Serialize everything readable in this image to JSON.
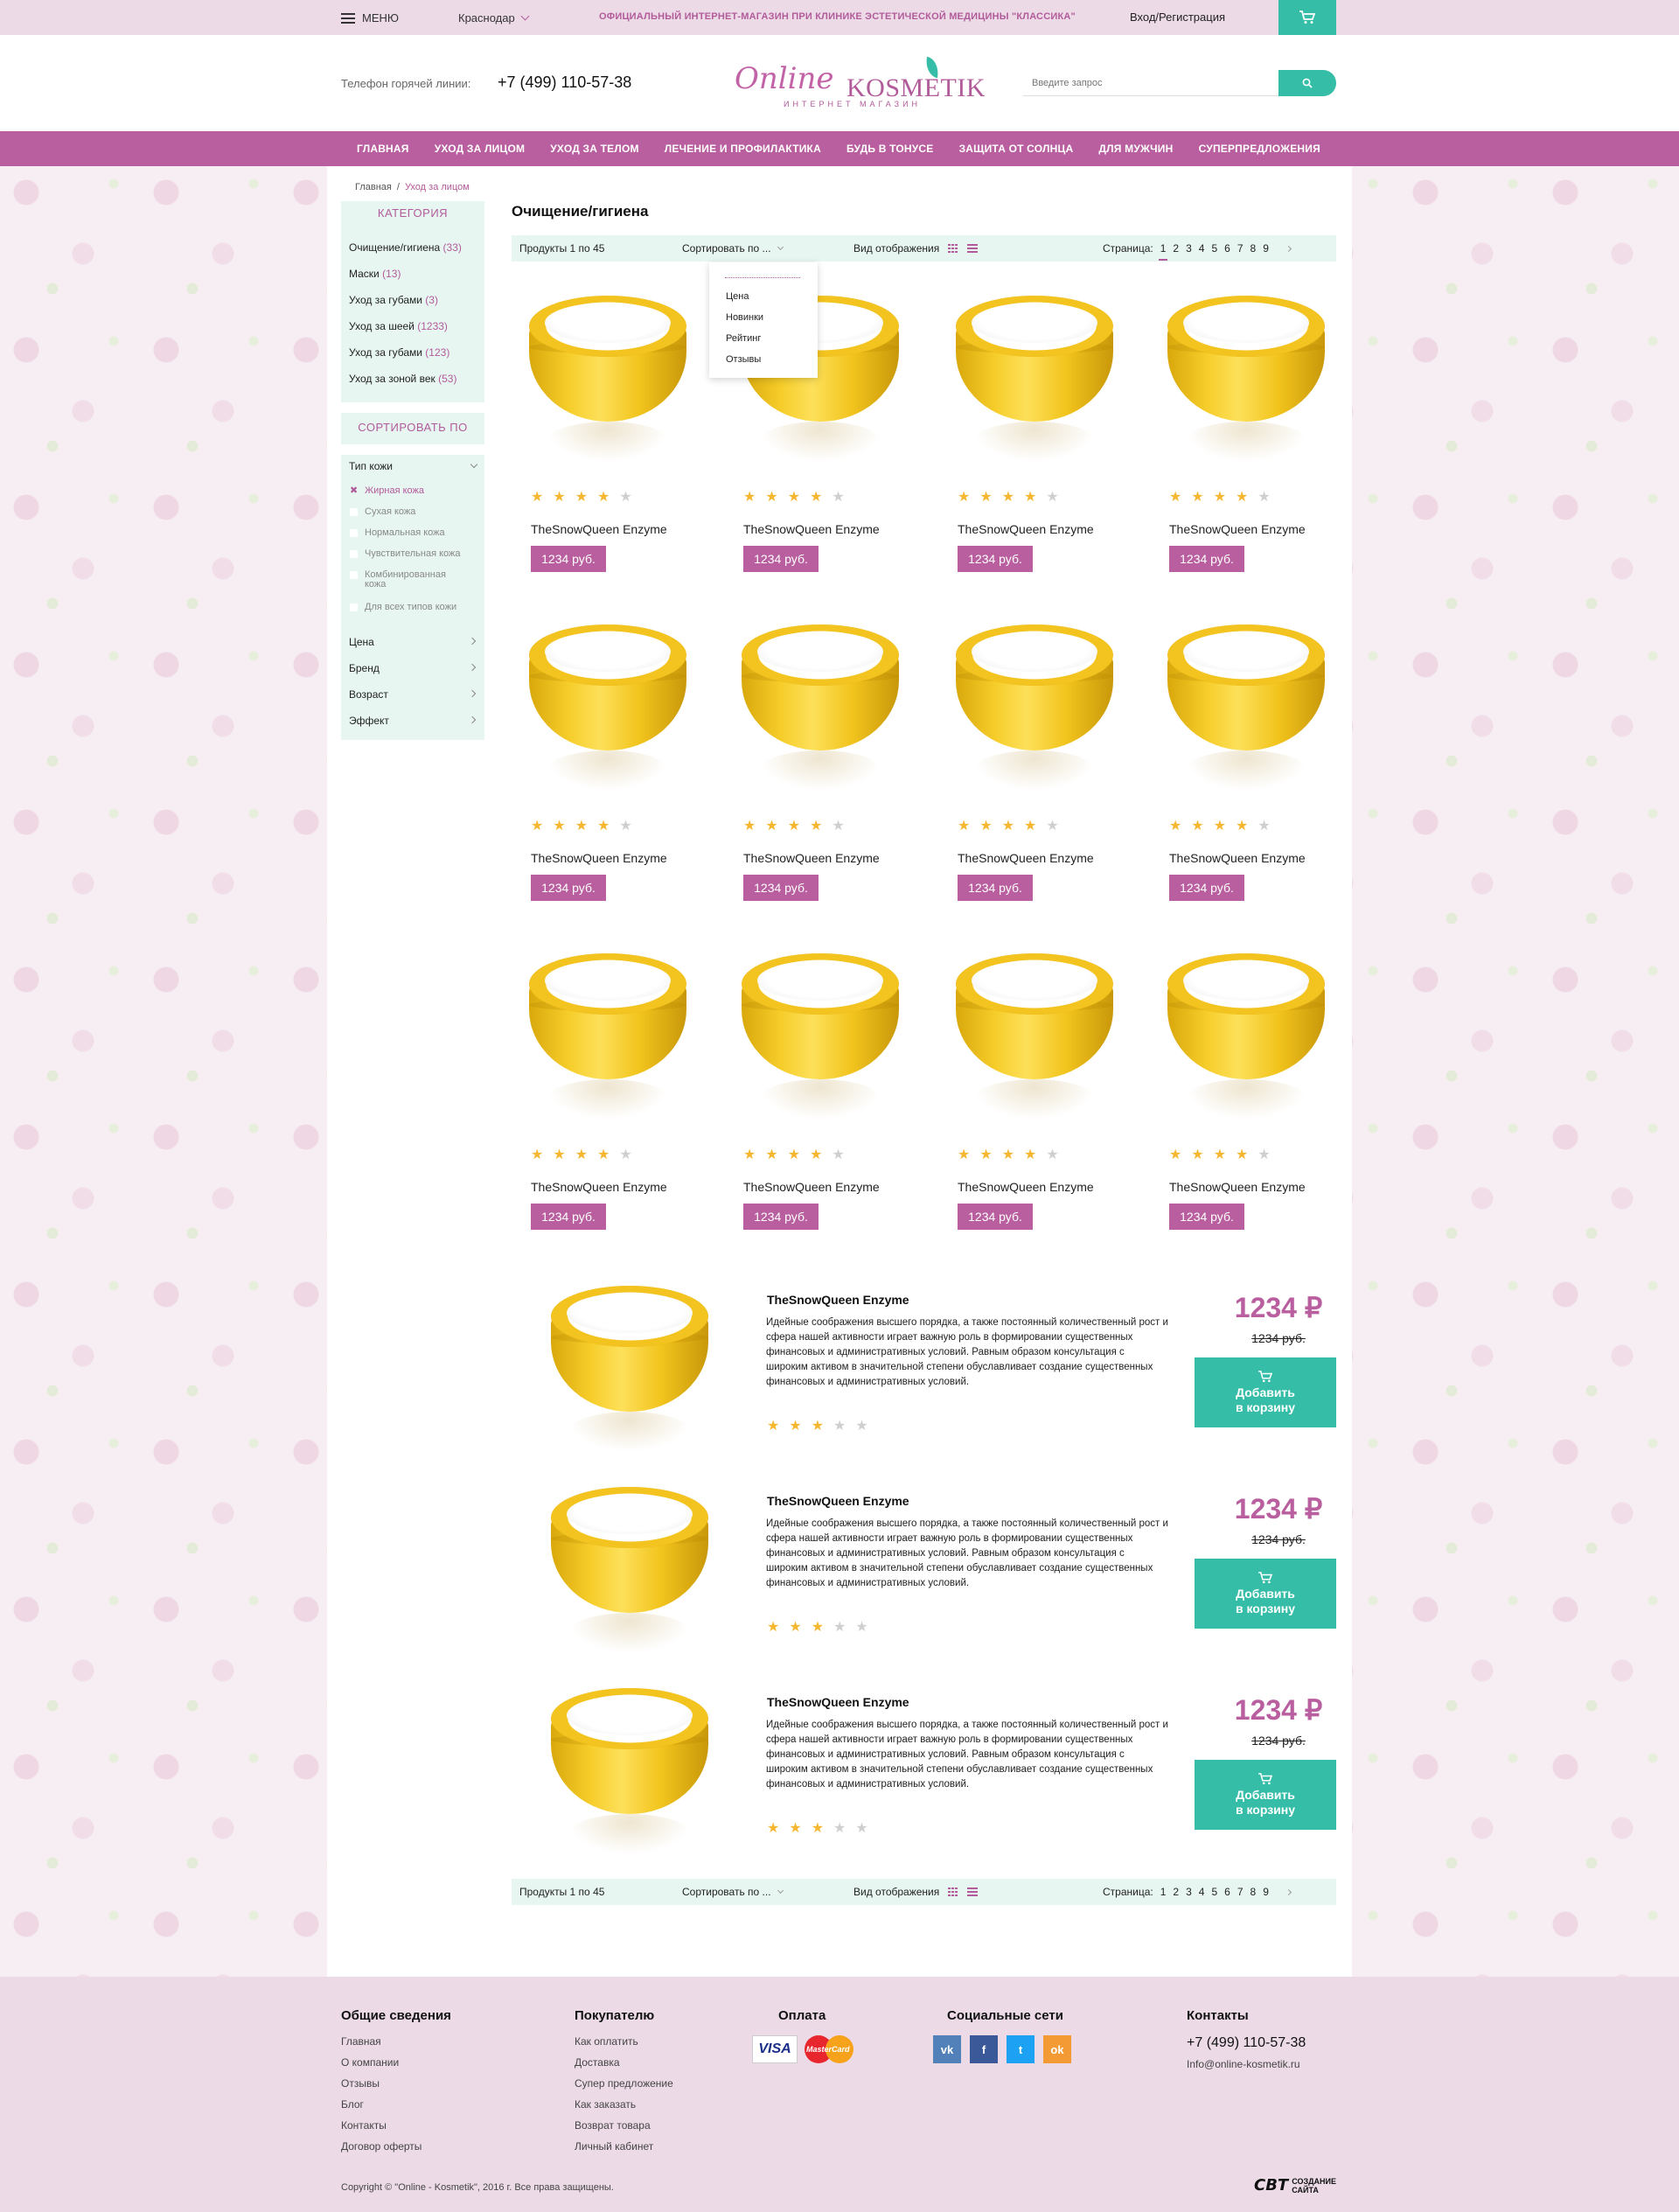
{
  "topbar": {
    "menu_label": "МЕНЮ",
    "city": "Краснодар",
    "official_text": "ОФИЦИАЛЬНЫЙ ИНТЕРНЕТ-МАГАЗИН ПРИ КЛИНИКЕ ЭСТЕТИЧЕСКОЙ МЕДИЦИНЫ \"КЛАССИКА\"",
    "login_label": "Вход/Регистрация",
    "cart_icon": "cart-icon"
  },
  "header": {
    "hotline_label": "Телефон горячей линии:",
    "hotline_phone": "+7 (499) 110-57-38",
    "logo_part1": "Online",
    "logo_part2": "KOSMETIK",
    "logo_sub": "ИНТЕРНЕТ МАГАЗИН",
    "search_placeholder": "Введите запрос",
    "search_icon": "search-icon"
  },
  "nav": [
    "ГЛАВНАЯ",
    "УХОД ЗА ЛИЦОМ",
    "УХОД ЗА ТЕЛОМ",
    "ЛЕЧЕНИЕ И ПРОФИЛАКТИКА",
    "БУДЬ В ТОНУСЕ",
    "ЗАЩИТА ОТ СОЛНЦА",
    "ДЛЯ МУЖЧИН",
    "СУПЕРПРЕДЛОЖЕНИЯ"
  ],
  "breadcrumb": {
    "home": "Главная",
    "sep": "/",
    "current": "Уход за лицом"
  },
  "sidebar": {
    "category_title": "КАТЕГОРИЯ",
    "categories": [
      {
        "label": "Очищение/гигиена",
        "count": "(33)"
      },
      {
        "label": "Маски",
        "count": "(13)"
      },
      {
        "label": "Уход за губами",
        "count": "(3)"
      },
      {
        "label": "Уход за шеей",
        "count": "(1233)"
      },
      {
        "label": "Уход за губами",
        "count": "(123)"
      },
      {
        "label": "Уход за зоной век",
        "count": "(53)"
      }
    ],
    "sort_title": "СОРТИРОВАТЬ ПО",
    "skin_type_label": "Тип кожи",
    "skin_options": [
      "Жирная кожа",
      "Сухая кожа",
      "Нормальная кожа",
      "Чувствительная кожа",
      "Комбинированная кожа",
      "Для всех типов кожи"
    ],
    "active_skin_mark": "✖",
    "filters": [
      "Цена",
      "Бренд",
      "Возраст",
      "Эффект"
    ]
  },
  "content": {
    "title": "Очищение/гигиена",
    "toolbar": {
      "count": "Продукты 1 по 45",
      "sort_label": "Сортировать по ...",
      "view_label": "Вид отображения",
      "pages_label": "Страница:",
      "pages": [
        "1",
        "2",
        "3",
        "4",
        "5",
        "6",
        "7",
        "8",
        "9"
      ],
      "current_page": "1"
    },
    "sort_options": [
      "Цена",
      "Новинки",
      "Рейтинг",
      "Отзывы"
    ],
    "grid_products": [
      {
        "name": "TheSnowQueen Enzyme",
        "price": "1234 руб.",
        "rating": 4
      },
      {
        "name": "TheSnowQueen Enzyme",
        "price": "1234 руб.",
        "rating": 4
      },
      {
        "name": "TheSnowQueen Enzyme",
        "price": "1234 руб.",
        "rating": 4
      },
      {
        "name": "TheSnowQueen Enzyme",
        "price": "1234 руб.",
        "rating": 4
      },
      {
        "name": "TheSnowQueen Enzyme",
        "price": "1234 руб.",
        "rating": 4
      },
      {
        "name": "TheSnowQueen Enzyme",
        "price": "1234 руб.",
        "rating": 4
      },
      {
        "name": "TheSnowQueen Enzyme",
        "price": "1234 руб.",
        "rating": 4
      },
      {
        "name": "TheSnowQueen Enzyme",
        "price": "1234 руб.",
        "rating": 4
      },
      {
        "name": "TheSnowQueen Enzyme",
        "price": "1234 руб.",
        "rating": 4
      },
      {
        "name": "TheSnowQueen Enzyme",
        "price": "1234 руб.",
        "rating": 4
      },
      {
        "name": "TheSnowQueen Enzyme",
        "price": "1234 руб.",
        "rating": 4
      },
      {
        "name": "TheSnowQueen Enzyme",
        "price": "1234 руб.",
        "rating": 4
      }
    ],
    "list_products": [
      {
        "name": "TheSnowQueen Enzyme",
        "description": "Идейные соображения высшего порядка, а также постоянный количественный рост и сфера нашей активности играет важную роль в формировании существенных финансовых и административных условий. Равным образом консультация с широким активом в значительной степени обуславливает создание существенных финансовых и административных условий.",
        "price": "1234 ₽",
        "old_price": "1234 руб.",
        "rating": 3,
        "button_line1": "Добавить",
        "button_line2": "в корзину"
      },
      {
        "name": "TheSnowQueen Enzyme",
        "description": "Идейные соображения высшего порядка, а также постоянный количественный рост и сфера нашей активности играет важную роль в формировании существенных финансовых и административных условий. Равным образом консультация с широким активом в значительной степени обуславливает создание существенных финансовых и административных условий.",
        "price": "1234 ₽",
        "old_price": "1234 руб.",
        "rating": 3,
        "button_line1": "Добавить",
        "button_line2": "в корзину"
      },
      {
        "name": "TheSnowQueen Enzyme",
        "description": "Идейные соображения высшего порядка, а также постоянный количественный рост и сфера нашей активности играет важную роль в формировании существенных финансовых и административных условий. Равным образом консультация с широким активом в значительной степени обуславливает создание существенных финансовых и административных условий.",
        "price": "1234 ₽",
        "old_price": "1234 руб.",
        "rating": 3,
        "button_line1": "Добавить",
        "button_line2": "в корзину"
      }
    ]
  },
  "footer": {
    "col1_title": "Общие сведения",
    "col1_links": [
      "Главная",
      "О компании",
      "Отзывы",
      "Блог",
      "Контакты",
      "Договор оферты"
    ],
    "col2_title": "Покупателю",
    "col2_links": [
      "Как оплатить",
      "Доставка",
      "Супер предложение",
      "Как заказать",
      "Возврат товара",
      "Личный кабинет"
    ],
    "col3_title": "Оплата",
    "visa": "VISA",
    "mastercard": "MasterCard",
    "col4_title": "Социальные сети",
    "social": [
      {
        "icon": "vk-icon",
        "text": "vk",
        "color": "#5181b8"
      },
      {
        "icon": "facebook-icon",
        "text": "f",
        "color": "#3b5998"
      },
      {
        "icon": "twitter-icon",
        "text": "t",
        "color": "#1da1f2"
      },
      {
        "icon": "odnoklassniki-icon",
        "text": "ok",
        "color": "#f39a35"
      }
    ],
    "col5_title": "Контакты",
    "phone": "+7 (499) 110-57-38",
    "email": "Info@online-kosmetik.ru",
    "copyright": "Copyright © \"Online - Kosmetik\", 2016 г.  Все права защищены.",
    "studio_mark": "СВТ",
    "studio_line1": "СОЗДАНИЕ",
    "studio_line2": "САЙТА"
  },
  "colors": {
    "accent": "#b95f9f",
    "teal": "#35bda8",
    "star": "#f5b730",
    "panel": "#e8f6f2"
  }
}
